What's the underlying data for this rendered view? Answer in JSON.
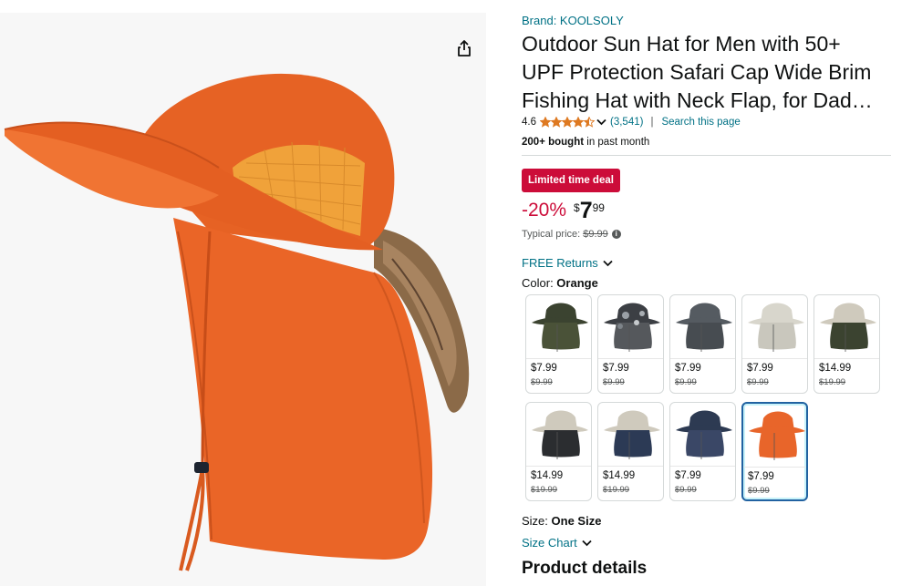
{
  "brand": "Brand: KOOLSOLY",
  "title_lines": [
    "Outdoor Sun Hat for Men with 50+",
    "UPF Protection Safari Cap Wide Brim",
    "Fishing Hat with Neck Flap, for Dad…"
  ],
  "rating": {
    "value": "4.6",
    "stars": 4.5,
    "count": "(3,541)",
    "separator": "|",
    "search_link": "Search this page"
  },
  "bought": {
    "bold": "200+ bought",
    "rest": " in past month"
  },
  "deal": {
    "badge": "Limited time deal",
    "discount": "-20%",
    "currency": "$",
    "whole": "7",
    "fraction": "99",
    "typical_label": "Typical price:",
    "typical_value": "$9.99"
  },
  "returns_label": "FREE Returns",
  "color": {
    "label": "Color: ",
    "selected": "Orange"
  },
  "swatches": [
    {
      "price": "$7.99",
      "old": "$9.99",
      "hat": "#3b4330",
      "flap": "#4a5238",
      "style": "plain"
    },
    {
      "price": "$7.99",
      "old": "$9.99",
      "hat": "#3c3f44",
      "flap": "#55585c",
      "style": "camo"
    },
    {
      "price": "$7.99",
      "old": "$9.99",
      "hat": "#555b61",
      "flap": "#474c51",
      "style": "plain"
    },
    {
      "price": "$7.99",
      "old": "$9.99",
      "hat": "#d8d6cc",
      "flap": "#c9c7bd",
      "style": "plain"
    },
    {
      "price": "$14.99",
      "old": "$19.99",
      "hat": "#cfcabd",
      "flap": "#3b4330",
      "style": "duo"
    },
    {
      "price": "$14.99",
      "old": "$19.99",
      "hat": "#cfcabd",
      "flap": "#2b2d30",
      "style": "duo"
    },
    {
      "price": "$14.99",
      "old": "$19.99",
      "hat": "#cfcabd",
      "flap": "#2c3a55",
      "style": "duo"
    },
    {
      "price": "$7.99",
      "old": "$9.99",
      "hat": "#2d3a52",
      "flap": "#3a4766",
      "style": "plain"
    },
    {
      "price": "$7.99",
      "old": "$9.99",
      "hat": "#e8652a",
      "flap": "#e8652a",
      "style": "orange",
      "selected": true
    }
  ],
  "size": {
    "label": "Size: ",
    "value": "One Size"
  },
  "size_chart_label": "Size Chart",
  "section_title": "Product details",
  "colors": {
    "link": "#007185",
    "deal": "#cc0c39",
    "star": "#de7921",
    "hat_orange": "#ec6a2c",
    "selected_border": "#2162a1"
  },
  "icons": [
    "share-icon",
    "star-icon",
    "chevron-down-icon",
    "info-icon"
  ]
}
